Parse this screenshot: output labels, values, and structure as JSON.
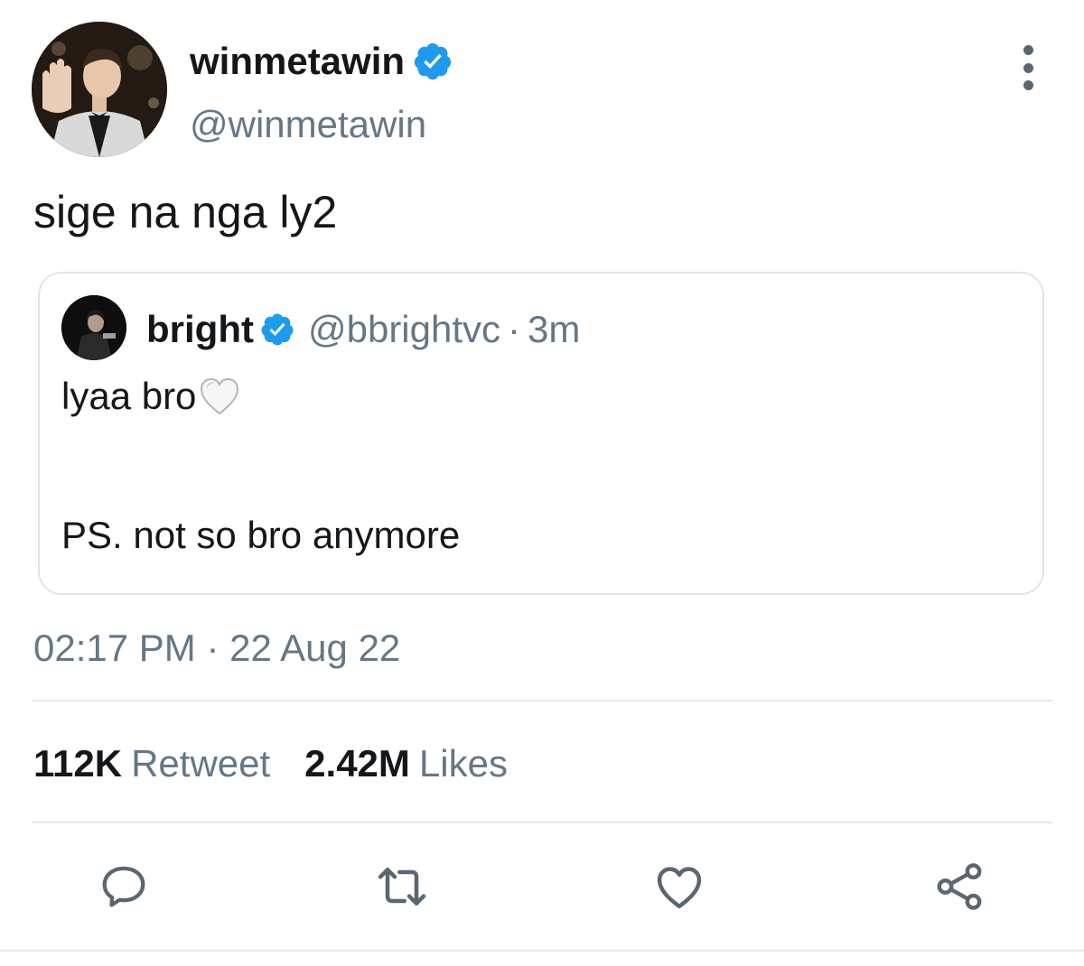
{
  "tweet": {
    "author": {
      "display_name": "winmetawin",
      "handle": "@winmetawin",
      "verified": true
    },
    "text": "sige na nga ly2",
    "quoted": {
      "display_name": "bright",
      "handle": "@bbrightvc",
      "separator": "·",
      "time_ago": "3m",
      "line1": "lyaa bro",
      "line2": "PS. not so bro anymore",
      "emoji": "white-heart"
    },
    "timestamp": "02:17 PM · 22 Aug 22",
    "stats": {
      "retweets_count": "112K",
      "retweets_label": "Retweet",
      "likes_count": "2.42M",
      "likes_label": "Likes"
    },
    "actions": [
      "reply-icon",
      "retweet-icon",
      "like-icon",
      "share-icon"
    ]
  },
  "colors": {
    "verified_blue": "#1d9bf0",
    "secondary_text": "#657786",
    "primary_text": "#14171a",
    "border": "#dfe5ea"
  }
}
